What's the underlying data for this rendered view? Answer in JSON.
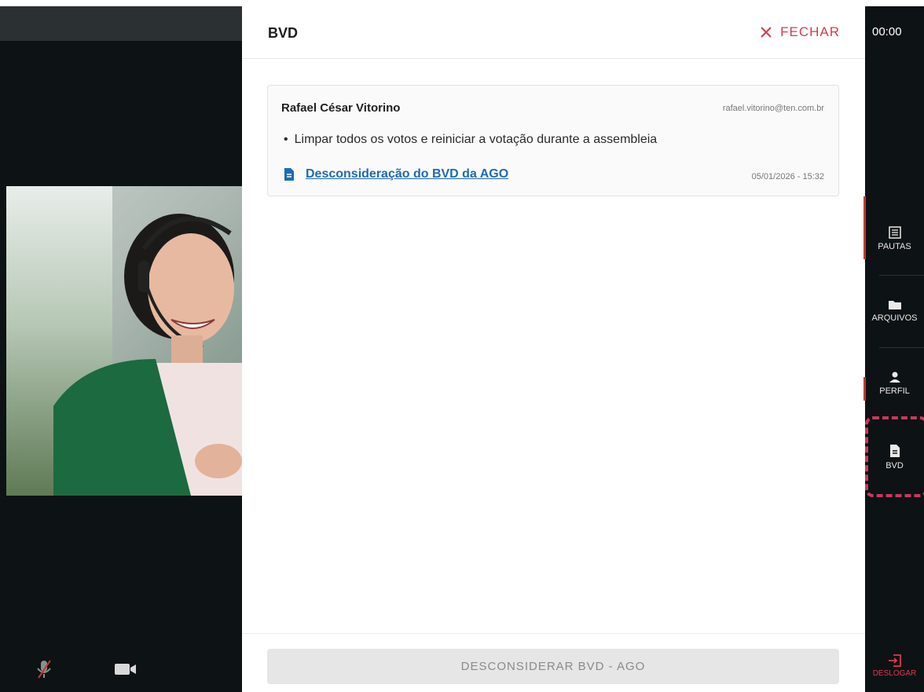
{
  "panel": {
    "title": "BVD",
    "close_label": "FECHAR",
    "footer_button": "DESCONSIDERAR BVD - AGO"
  },
  "card": {
    "name": "Rafael César Vitorino",
    "email": "rafael.vitorino@ten.com.br",
    "bullet": "Limpar todos os votos e reiniciar a votação durante a assembleia",
    "link": "Desconsideração do BVD da AGO",
    "datetime": "05/01/2026 - 15:32"
  },
  "sidebar": {
    "timer": "00:00",
    "items": [
      {
        "label": "PAUTAS",
        "icon": "list-icon"
      },
      {
        "label": "ARQUIVOS",
        "icon": "folder-icon"
      },
      {
        "label": "PERFIL",
        "icon": "person-icon"
      },
      {
        "label": "BVD",
        "icon": "document-icon"
      }
    ],
    "logout": "DESLOGAR"
  },
  "video": {
    "mic": "muted-mic-icon",
    "camera": "camera-icon"
  },
  "colors": {
    "accent_red": "#d63a4f",
    "link_blue": "#1e6bb0",
    "dark_bg": "#0d1214",
    "highlight": "#c8385b"
  }
}
